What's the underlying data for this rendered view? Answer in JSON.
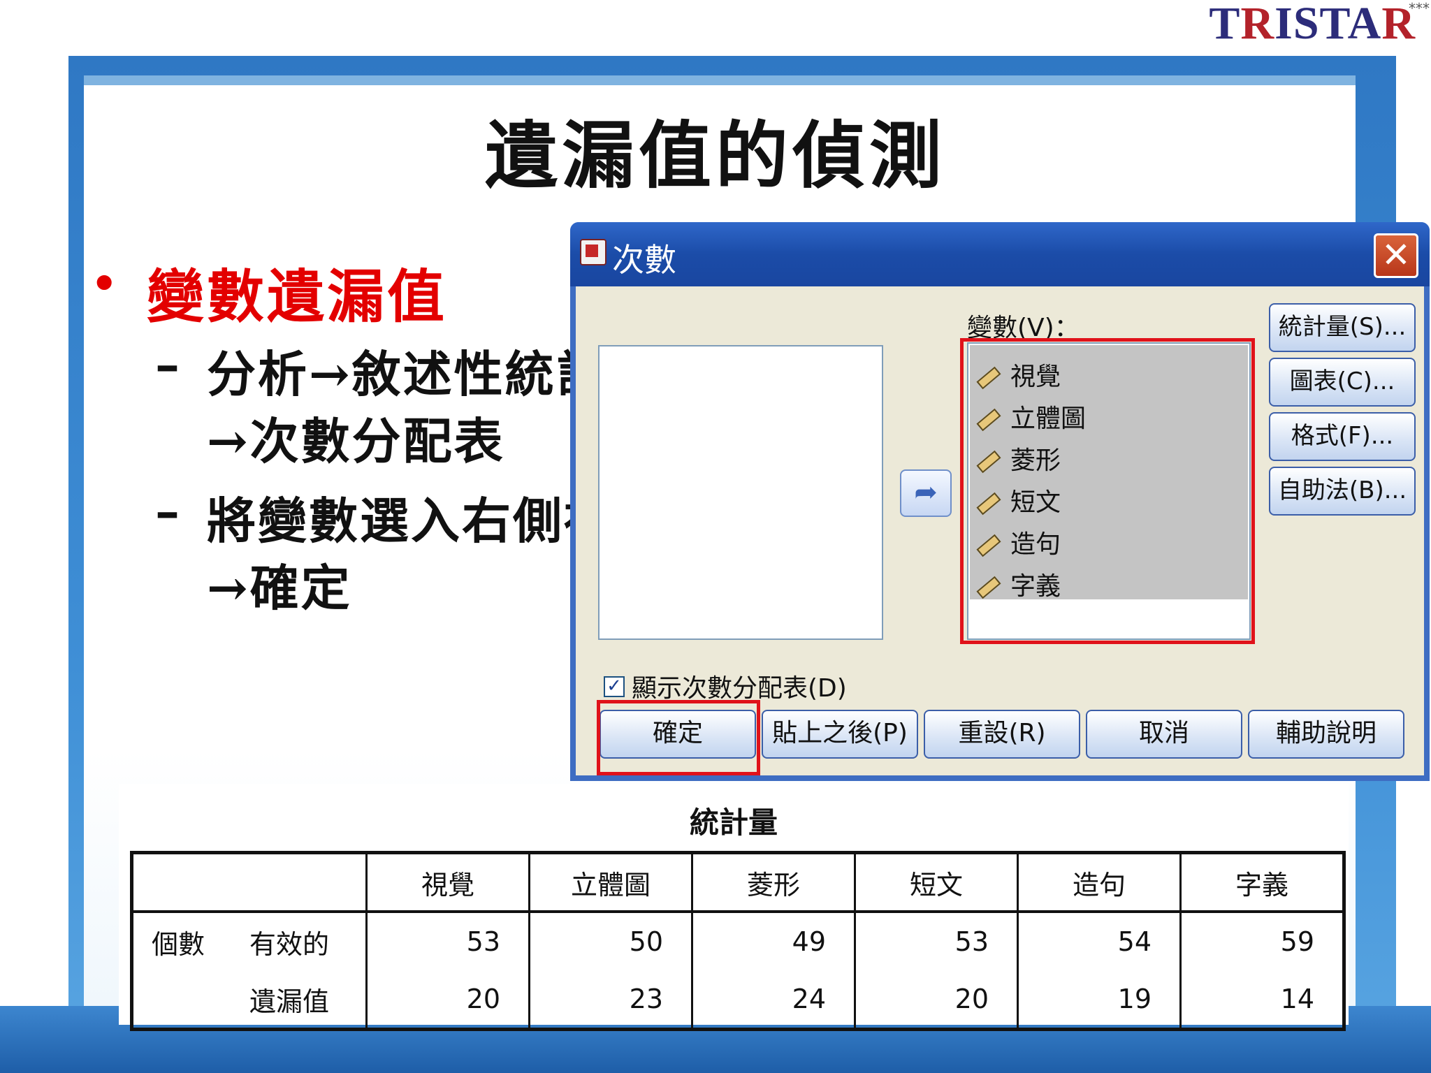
{
  "logo": {
    "text": "TRISTAR",
    "stars": "***"
  },
  "slide": {
    "title": "遺漏值的偵測",
    "bullet": "變數遺漏值",
    "sub1_line1": "分析→敘述性統計",
    "sub1_line2": "→次數分配表",
    "sub2_line1": "將變數選入右側視窗",
    "sub2_line2": "→確定",
    "dash": "–"
  },
  "dialog": {
    "title": "次數",
    "close_glyph": "✕",
    "move_glyph": "➦",
    "variables_label": "變數(V)：",
    "variables": [
      "視覺",
      "立體圖",
      "菱形",
      "短文",
      "造句",
      "字義"
    ],
    "side_buttons": [
      "統計量(S)...",
      "圖表(C)...",
      "格式(F)...",
      "自助法(B)..."
    ],
    "checkbox_label": "顯示次數分配表(D)",
    "checkbox_checked": true,
    "buttons": [
      "確定",
      "貼上之後(P)",
      "重設(R)",
      "取消",
      "輔助說明"
    ]
  },
  "stats": {
    "title": "統計量",
    "columns": [
      "視覺",
      "立體圖",
      "菱形",
      "短文",
      "造句",
      "字義"
    ],
    "row_group": "個數",
    "rows": [
      {
        "label": "有效的",
        "values": [
          "53",
          "50",
          "49",
          "53",
          "54",
          "59"
        ]
      },
      {
        "label": "遺漏值",
        "values": [
          "20",
          "23",
          "24",
          "20",
          "19",
          "14"
        ]
      }
    ]
  },
  "colors": {
    "accent_red": "#e30000",
    "highlight_box": "#e0121a",
    "titlebar": "#1b4ca8"
  }
}
